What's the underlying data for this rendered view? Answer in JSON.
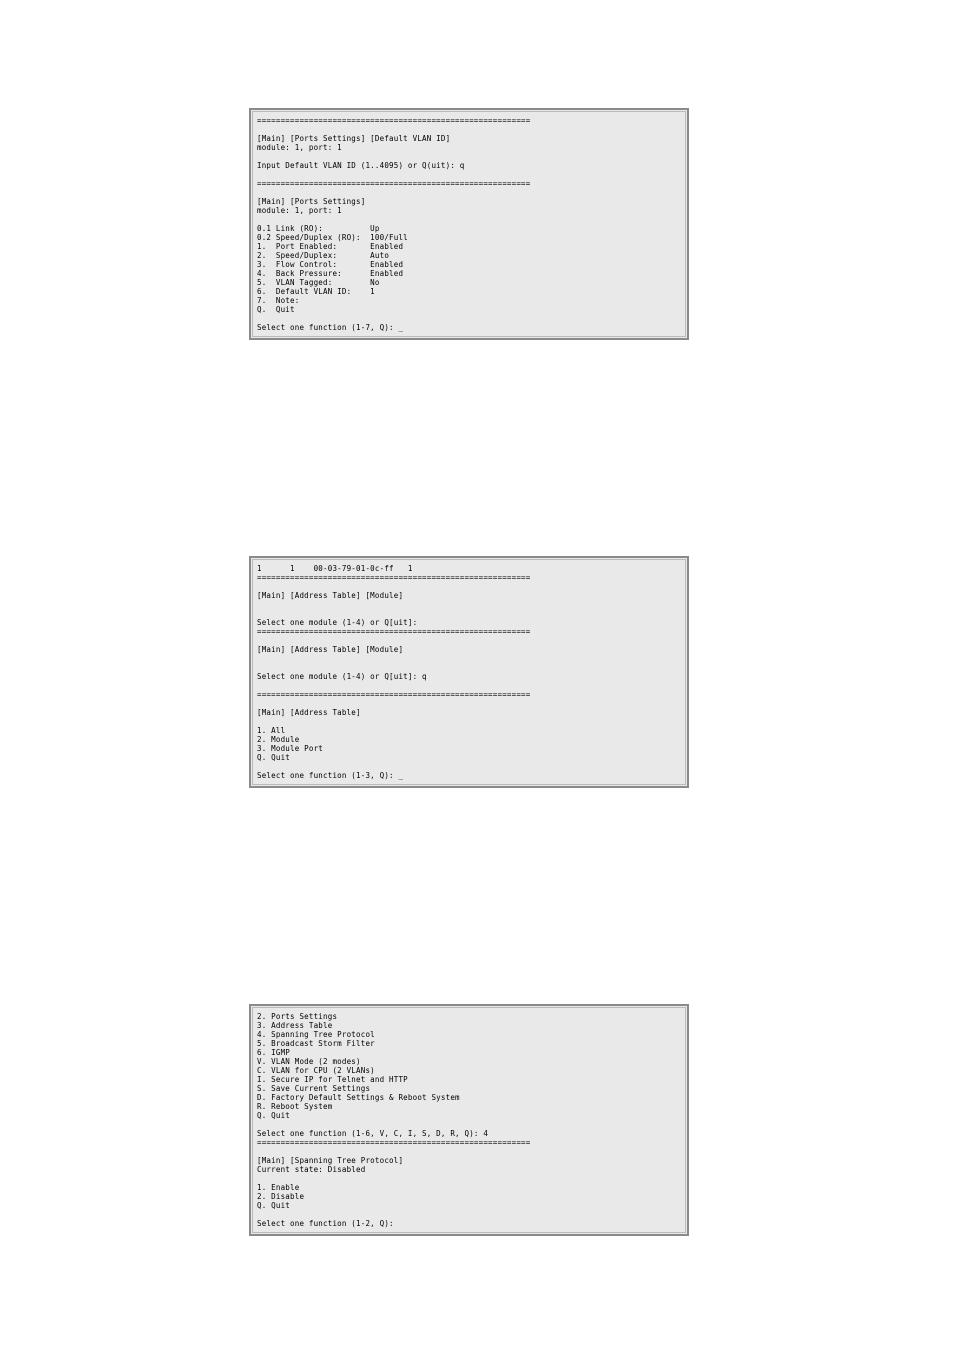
{
  "screens": {
    "screen1": {
      "text": "==========================================================\n\n[Main] [Ports Settings] [Default VLAN ID]\nmodule: 1, port: 1\n\nInput Default VLAN ID (1..4095) or Q(uit): q\n\n==========================================================\n\n[Main] [Ports Settings]\nmodule: 1, port: 1\n\n0.1 Link (RO):          Up\n0.2 Speed/Duplex (RO):  100/Full\n1.  Port Enabled:       Enabled\n2.  Speed/Duplex:       Auto\n3.  Flow Control:       Enabled\n4.  Back Pressure:      Enabled\n5.  VLAN Tagged:        No\n6.  Default VLAN ID:    1\n7.  Note:\nQ.  Quit\n\nSelect one function (1-7, Q): _"
    },
    "screen2": {
      "text": "1      1    00-03-79-01-0c-ff   1\n==========================================================\n\n[Main] [Address Table] [Module]\n\n\nSelect one module (1-4) or Q[uit]:\n==========================================================\n\n[Main] [Address Table] [Module]\n\n\nSelect one module (1-4) or Q[uit]: q\n\n==========================================================\n\n[Main] [Address Table]\n\n1. All\n2. Module\n3. Module Port\nQ. Quit\n\nSelect one function (1-3, Q): _"
    },
    "screen3": {
      "text": "2. Ports Settings\n3. Address Table\n4. Spanning Tree Protocol\n5. Broadcast Storm Filter\n6. IGMP\nV. VLAN Mode (2 modes)\nC. VLAN for CPU (2 VLANs)\nI. Secure IP for Telnet and HTTP\nS. Save Current Settings\nD. Factory Default Settings & Reboot System\nR. Reboot System\nQ. Quit\n\nSelect one function (1-6, V, C, I, S, D, R, Q): 4\n==========================================================\n\n[Main] [Spanning Tree Protocol]\nCurrent state: Disabled\n\n1. Enable\n2. Disable\nQ. Quit\n\nSelect one function (1-2, Q):"
    }
  }
}
